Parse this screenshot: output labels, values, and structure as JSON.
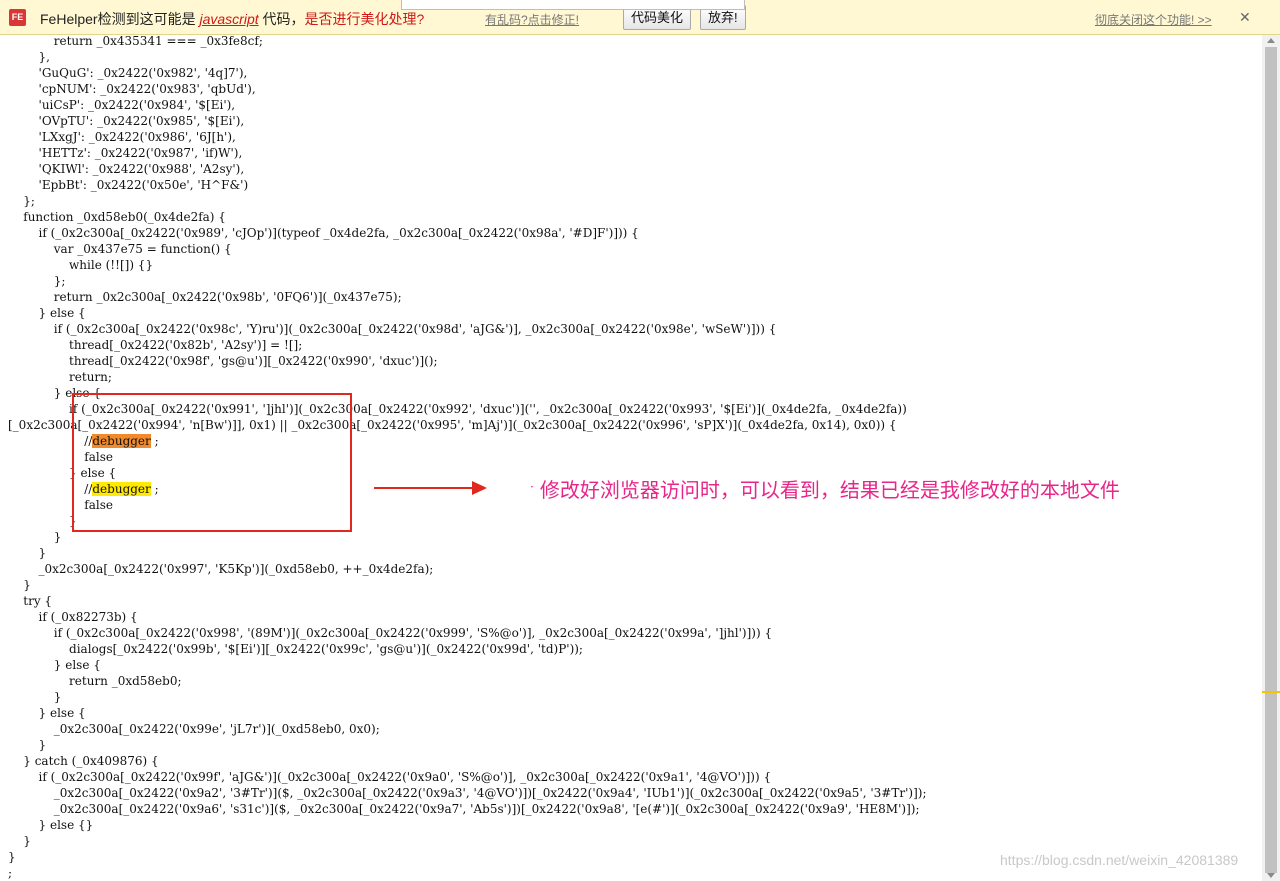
{
  "notification_bar": {
    "logo": "FE",
    "message_prefix": "FeHelper检测到这可能是",
    "language": "javascript",
    "message_mid": "代码，",
    "message_question": "是否进行美化处理?",
    "fix_garbled_link": "有乱码?点击修正!",
    "beautify_button": "代码美化",
    "dismiss_button": "放弃!",
    "disable_link": "彻底关闭这个功能! >>",
    "close_icon": "close-icon",
    "accent_color": "#d01818"
  },
  "code_lines": [
    "            return _0x435341 === _0x3fe8cf;",
    "        },",
    "        'GuQuG': _0x2422('0x982', '4q]7'),",
    "        'cpNUM': _0x2422('0x983', 'qbUd'),",
    "        'uiCsP': _0x2422('0x984', '$[Ei'),",
    "        'OVpTU': _0x2422('0x985', '$[Ei'),",
    "        'LXxgJ': _0x2422('0x986', '6J[h'),",
    "        'HETTz': _0x2422('0x987', 'if)W'),",
    "        'QKIWl': _0x2422('0x988', 'A2sy'),",
    "        'EpbBt': _0x2422('0x50e', 'H^F&')",
    "    };",
    "    function _0xd58eb0(_0x4de2fa) {",
    "        if (_0x2c300a[_0x2422('0x989', 'cJOp')](typeof _0x4de2fa, _0x2c300a[_0x2422('0x98a', '#D]F')])) {",
    "            var _0x437e75 = function() {",
    "                while (!![]) {}",
    "            };",
    "            return _0x2c300a[_0x2422('0x98b', '0FQ6')](_0x437e75);",
    "        } else {",
    "            if (_0x2c300a[_0x2422('0x98c', 'Y)ru')](_0x2c300a[_0x2422('0x98d', 'aJG&')], _0x2c300a[_0x2422('0x98e', 'wSeW')])) {",
    "                thread[_0x2422('0x82b', 'A2sy')] = ![];",
    "                thread[_0x2422('0x98f', 'gs@u')][_0x2422('0x990', 'dxuc')]();",
    "                return;",
    "            } else {",
    "                if (_0x2c300a[_0x2422('0x991', ']jhl')](_0x2c300a[_0x2422('0x992', 'dxuc')]('', _0x2c300a[_0x2422('0x993', '$[Ei')](_0x4de2fa, _0x4de2fa))",
    "[_0x2c300a[_0x2422('0x994', 'n[Bw')]], 0x1) || _0x2c300a[_0x2422('0x995', 'm]Aj')](_0x2c300a[_0x2422('0x996', 'sP]X')](_0x4de2fa, 0x14), 0x0)) {",
    "                    //debugger ;",
    "                    false",
    "                } else {",
    "                    //debugger ;",
    "                    false",
    "                }",
    "            }",
    "        }",
    "        _0x2c300a[_0x2422('0x997', 'K5Kp')](_0xd58eb0, ++_0x4de2fa);",
    "    }",
    "    try {",
    "        if (_0x82273b) {",
    "            if (_0x2c300a[_0x2422('0x998', '(89M')](_0x2c300a[_0x2422('0x999', 'S%@o')], _0x2c300a[_0x2422('0x99a', ']jhl')])) {",
    "                dialogs[_0x2422('0x99b', '$[Ei')][_0x2422('0x99c', 'gs@u')](_0x2422('0x99d', 'td)P'));",
    "            } else {",
    "                return _0xd58eb0;",
    "            }",
    "        } else {",
    "            _0x2c300a[_0x2422('0x99e', 'jL7r')](_0xd58eb0, 0x0);",
    "        }",
    "    } catch (_0x409876) {",
    "        if (_0x2c300a[_0x2422('0x99f', 'aJG&')](_0x2c300a[_0x2422('0x9a0', 'S%@o')], _0x2c300a[_0x2422('0x9a1', '4@VO')])) {",
    "            _0x2c300a[_0x2422('0x9a2', '3#Tr')]($, _0x2c300a[_0x2422('0x9a3', '4@VO')])[_0x2422('0x9a4', 'IUb1')](_0x2c300a[_0x2422('0x9a5', '3#Tr')]);",
    "            _0x2c300a[_0x2422('0x9a6', 's31c')]($, _0x2c300a[_0x2422('0x9a7', 'Ab5s')])[_0x2422('0x9a8', '[e(#')](_0x2c300a[_0x2422('0x9a9', 'HE8M')]);",
    "        } else {}",
    "    }",
    "}",
    ";"
  ],
  "highlights": {
    "debugger_word": "debugger",
    "first_color": "#f08a2c",
    "second_color": "#ffea00"
  },
  "annotation": {
    "text": "修改好浏览器访问时，可以看到，结果已经是我修改好的本地文件",
    "box_color": "#e0281e",
    "text_color": "#e8268a"
  },
  "watermark": "https://blog.csdn.net/weixin_42081389"
}
